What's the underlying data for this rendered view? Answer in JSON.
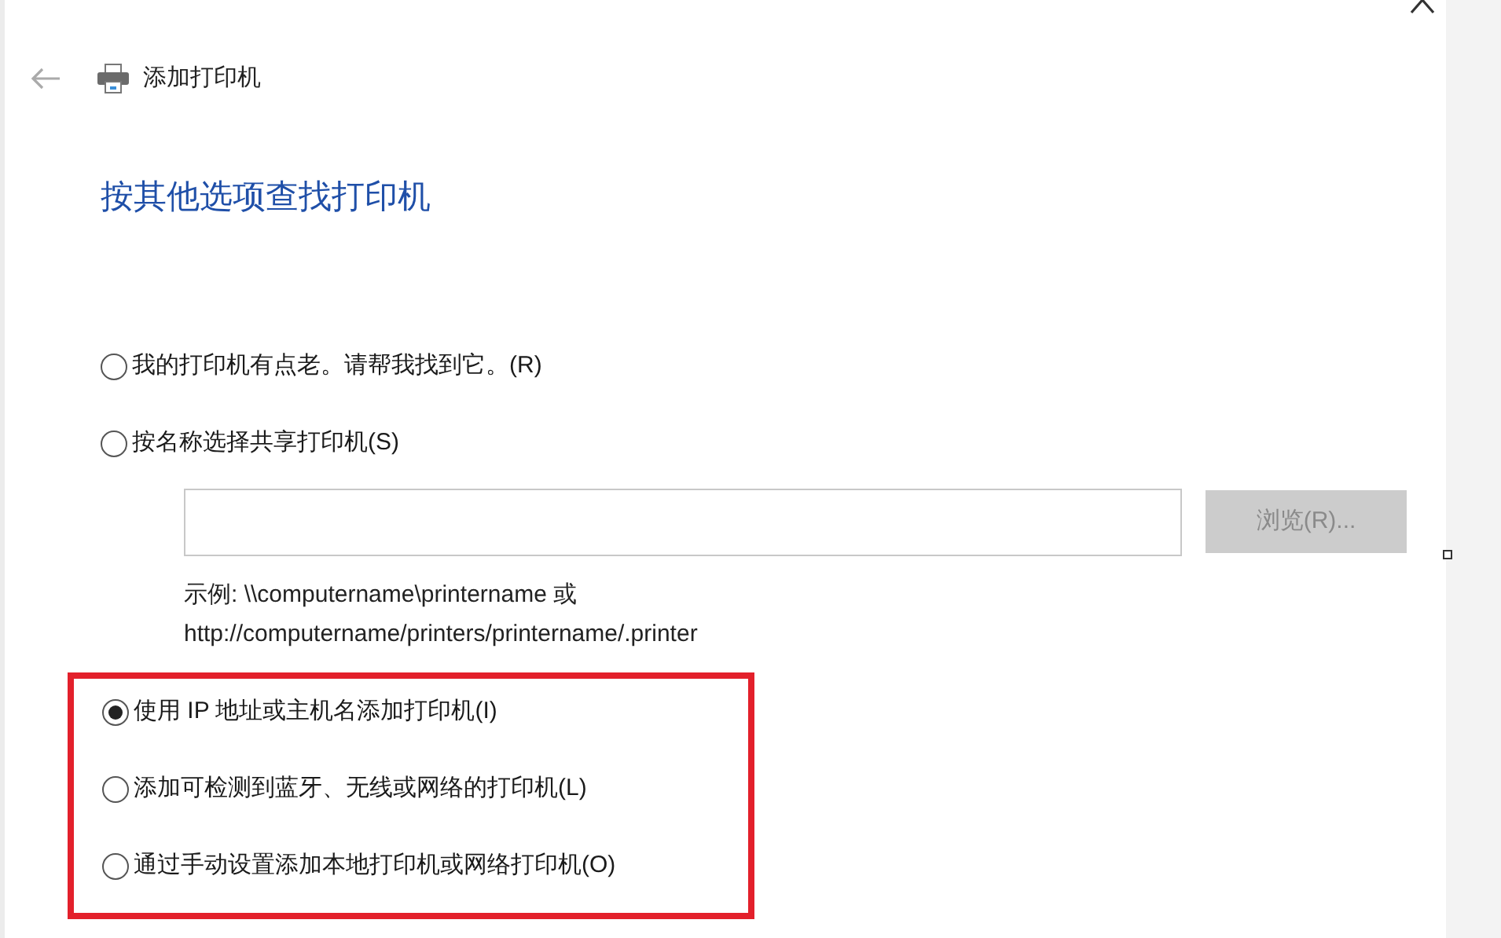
{
  "header": {
    "title": "添加打印机"
  },
  "heading": "按其他选项查找打印机",
  "options": [
    {
      "label": "我的打印机有点老。请帮我找到它。(R)",
      "selected": false
    },
    {
      "label": "按名称选择共享打印机(S)",
      "selected": false
    }
  ],
  "share_field": {
    "button": "浏览(R)...",
    "button_disabled": true,
    "example_lines": [
      "示例: \\\\computername\\printername 或",
      "http://computername/printers/printername/.printer"
    ]
  },
  "highlight_box": {
    "options": [
      {
        "label": "使用 IP 地址或主机名添加打印机(I)",
        "selected": true
      },
      {
        "label": "添加可检测到蓝牙、无线或网络的打印机(L)",
        "selected": false
      },
      {
        "label": "通过手动设置添加本地打印机或网络打印机(O)",
        "selected": false
      }
    ]
  }
}
